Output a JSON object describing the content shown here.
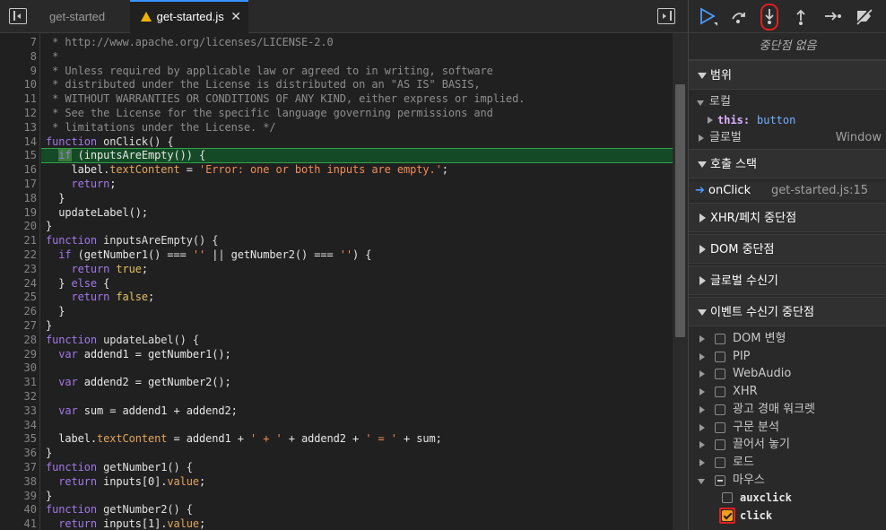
{
  "editor": {
    "tabs": [
      {
        "label": "get-started"
      },
      {
        "label": "get-started.js"
      }
    ],
    "lines": [
      {
        "n": "7",
        "segs": [
          [
            "c-com",
            " * http://www.apache.org/licenses/LICENSE-2.0"
          ]
        ]
      },
      {
        "n": "8",
        "segs": [
          [
            "c-com",
            " *"
          ]
        ]
      },
      {
        "n": "9",
        "segs": [
          [
            "c-com",
            " * Unless required by applicable law or agreed to in writing, software"
          ]
        ]
      },
      {
        "n": "10",
        "segs": [
          [
            "c-com",
            " * distributed under the License is distributed on an \"AS IS\" BASIS,"
          ]
        ]
      },
      {
        "n": "11",
        "segs": [
          [
            "c-com",
            " * WITHOUT WARRANTIES OR CONDITIONS OF ANY KIND, either express or implied."
          ]
        ]
      },
      {
        "n": "12",
        "segs": [
          [
            "c-com",
            " * See the License for the specific language governing permissions and"
          ]
        ]
      },
      {
        "n": "13",
        "segs": [
          [
            "c-com",
            " * limitations under the License. */"
          ]
        ]
      },
      {
        "n": "14",
        "segs": [
          [
            "c-kw",
            "function "
          ],
          [
            "c-fn",
            "onClick() {"
          ]
        ]
      },
      {
        "n": "15",
        "segs": [
          [
            "c-txt",
            "  "
          ],
          [
            "c-kw c-hl",
            "if"
          ],
          [
            "c-txt",
            " (inputsAreEmpty()) {"
          ]
        ]
      },
      {
        "n": "16",
        "segs": [
          [
            "c-txt",
            "    label."
          ],
          [
            "c-prop",
            "textContent"
          ],
          [
            "c-txt",
            " = "
          ],
          [
            "c-str",
            "'Error: one or both inputs are empty.'"
          ],
          [
            "c-txt",
            ";"
          ]
        ]
      },
      {
        "n": "17",
        "segs": [
          [
            "c-txt",
            "    "
          ],
          [
            "c-kw",
            "return"
          ],
          [
            "c-txt",
            ";"
          ]
        ]
      },
      {
        "n": "18",
        "segs": [
          [
            "c-txt",
            "  }"
          ]
        ]
      },
      {
        "n": "19",
        "segs": [
          [
            "c-txt",
            "  updateLabel();"
          ]
        ]
      },
      {
        "n": "20",
        "segs": [
          [
            "c-txt",
            "}"
          ]
        ]
      },
      {
        "n": "21",
        "segs": [
          [
            "c-kw",
            "function "
          ],
          [
            "c-fn",
            "inputsAreEmpty() {"
          ]
        ]
      },
      {
        "n": "22",
        "segs": [
          [
            "c-txt",
            "  "
          ],
          [
            "c-kw",
            "if"
          ],
          [
            "c-txt",
            " (getNumber1() === "
          ],
          [
            "c-str",
            "''"
          ],
          [
            "c-txt",
            " || getNumber2() === "
          ],
          [
            "c-str",
            "''"
          ],
          [
            "c-txt",
            ") {"
          ]
        ]
      },
      {
        "n": "23",
        "segs": [
          [
            "c-txt",
            "    "
          ],
          [
            "c-kw",
            "return "
          ],
          [
            "c-bool",
            "true"
          ],
          [
            "c-txt",
            ";"
          ]
        ]
      },
      {
        "n": "24",
        "segs": [
          [
            "c-txt",
            "  } "
          ],
          [
            "c-kw",
            "else"
          ],
          [
            "c-txt",
            " {"
          ]
        ]
      },
      {
        "n": "25",
        "segs": [
          [
            "c-txt",
            "    "
          ],
          [
            "c-kw",
            "return "
          ],
          [
            "c-bool",
            "false"
          ],
          [
            "c-txt",
            ";"
          ]
        ]
      },
      {
        "n": "26",
        "segs": [
          [
            "c-txt",
            "  }"
          ]
        ]
      },
      {
        "n": "27",
        "segs": [
          [
            "c-txt",
            "}"
          ]
        ]
      },
      {
        "n": "28",
        "segs": [
          [
            "c-kw",
            "function "
          ],
          [
            "c-fn",
            "updateLabel() {"
          ]
        ]
      },
      {
        "n": "29",
        "segs": [
          [
            "c-txt",
            "  "
          ],
          [
            "c-kw",
            "var"
          ],
          [
            "c-txt",
            " addend1 = getNumber1();"
          ]
        ]
      },
      {
        "n": "30",
        "segs": []
      },
      {
        "n": "31",
        "segs": [
          [
            "c-txt",
            "  "
          ],
          [
            "c-kw",
            "var"
          ],
          [
            "c-txt",
            " addend2 = getNumber2();"
          ]
        ]
      },
      {
        "n": "32",
        "segs": []
      },
      {
        "n": "33",
        "segs": [
          [
            "c-txt",
            "  "
          ],
          [
            "c-kw",
            "var"
          ],
          [
            "c-txt",
            " sum = addend1 + addend2;"
          ]
        ]
      },
      {
        "n": "34",
        "segs": []
      },
      {
        "n": "35",
        "segs": [
          [
            "c-txt",
            "  label."
          ],
          [
            "c-prop",
            "textContent"
          ],
          [
            "c-txt",
            " = addend1 + "
          ],
          [
            "c-str",
            "' + '"
          ],
          [
            "c-txt",
            " + addend2 + "
          ],
          [
            "c-str",
            "' = '"
          ],
          [
            "c-txt",
            " + sum;"
          ]
        ]
      },
      {
        "n": "36",
        "segs": [
          [
            "c-txt",
            "}"
          ]
        ]
      },
      {
        "n": "37",
        "segs": [
          [
            "c-kw",
            "function "
          ],
          [
            "c-fn",
            "getNumber1() {"
          ]
        ]
      },
      {
        "n": "38",
        "segs": [
          [
            "c-txt",
            "  "
          ],
          [
            "c-kw",
            "return"
          ],
          [
            "c-txt",
            " inputs[0]."
          ],
          [
            "c-prop",
            "value"
          ],
          [
            "c-txt",
            ";"
          ]
        ]
      },
      {
        "n": "39",
        "segs": [
          [
            "c-txt",
            "}"
          ]
        ]
      },
      {
        "n": "40",
        "segs": [
          [
            "c-kw",
            "function "
          ],
          [
            "c-fn",
            "getNumber2() {"
          ]
        ]
      },
      {
        "n": "41",
        "segs": [
          [
            "c-txt",
            "  "
          ],
          [
            "c-kw",
            "return"
          ],
          [
            "c-txt",
            " inputs[1]."
          ],
          [
            "c-prop",
            "value"
          ],
          [
            "c-txt",
            ";"
          ]
        ]
      }
    ]
  },
  "debugger": {
    "no_breakpoint": "중단점 없음",
    "scope": {
      "title": "범위",
      "local_label": "로컬",
      "this_key": "this:",
      "this_value": "button",
      "global_label": "글로벌",
      "global_value": "Window"
    },
    "call_stack": {
      "title": "호출 스택",
      "frame_fn": "onClick",
      "frame_loc": "get-started.js:15"
    },
    "sections": {
      "xhr": "XHR/페치 중단점",
      "dom": "DOM 중단점",
      "global_listeners": "글로벌 수신기",
      "event_listener_bp": "이벤트 수신기 중단점"
    },
    "event_categories": [
      {
        "label": "DOM 변형"
      },
      {
        "label": "PIP"
      },
      {
        "label": "WebAudio"
      },
      {
        "label": "XHR"
      },
      {
        "label": "광고 경매 워크렛"
      },
      {
        "label": "구문 분석"
      },
      {
        "label": "끌어서 놓기"
      },
      {
        "label": "로드"
      },
      {
        "label": "마우스"
      }
    ],
    "mouse_events": [
      {
        "label": "auxclick",
        "checked": false
      },
      {
        "label": "click",
        "checked": true
      }
    ],
    "colors": {
      "accent": "#3794ff",
      "paused_line": "#154a26",
      "checkbox_checked": "#f0a020",
      "annotation_red": "#e02020"
    }
  }
}
